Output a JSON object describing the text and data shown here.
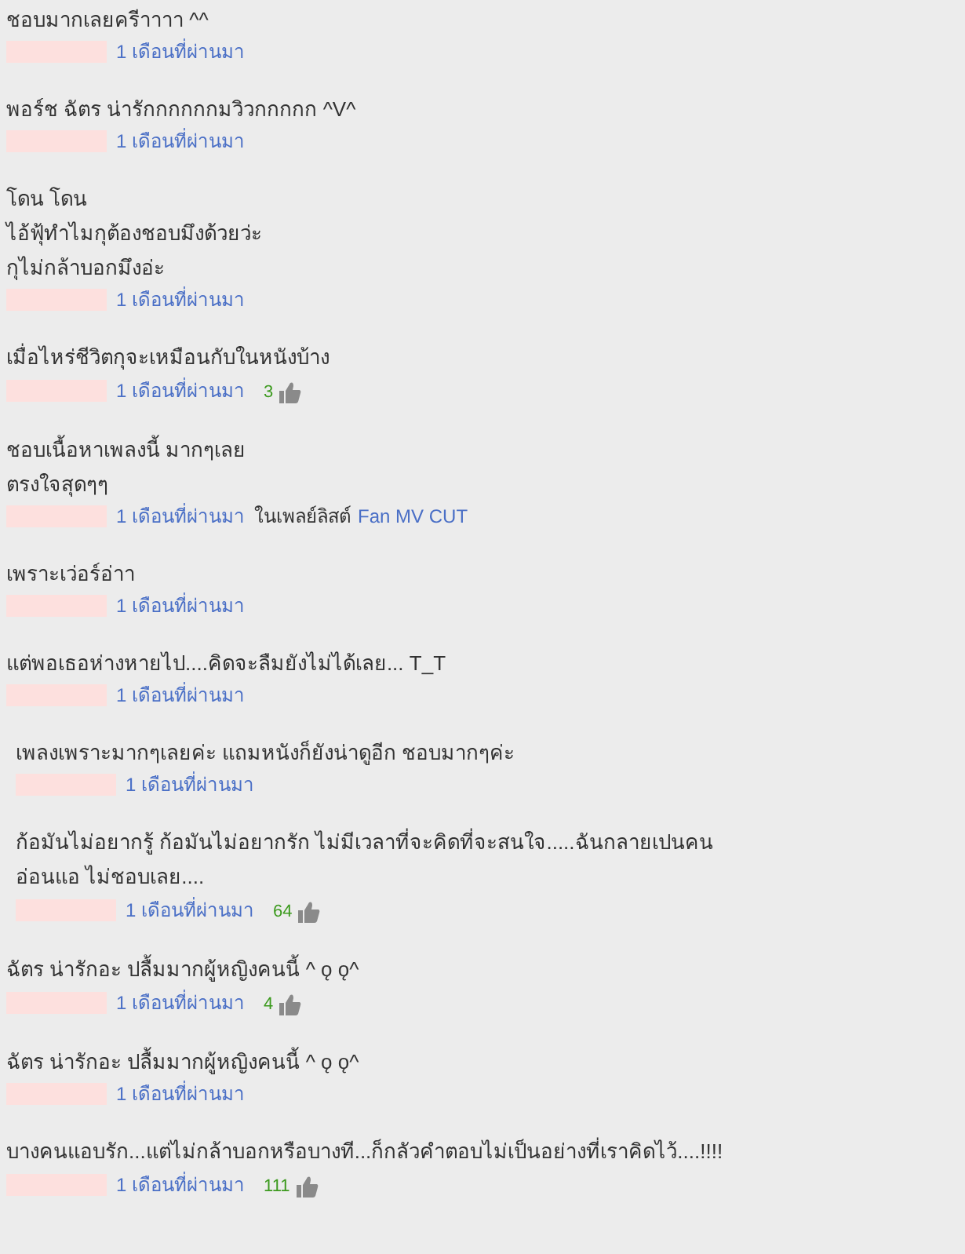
{
  "comments": [
    {
      "kind": "comment",
      "author_redacted": true,
      "lines": [
        "ชอบมากเลยครีาาาา ^^"
      ],
      "time": "1 เดือนที่ผ่านมา"
    },
    {
      "kind": "comment",
      "author_redacted": true,
      "lines": [
        "พอร์ช ฉัตร น่ารักกกกกกมวิวกกกกก ^V^"
      ],
      "time": "1 เดือนที่ผ่านมา"
    },
    {
      "kind": "comment",
      "author_redacted": true,
      "lines": [
        "โดน โดน",
        "ไอ้ฟุ้ทำไมกุต้องชอบมึงด้วยว่ะ",
        "กุไม่กล้าบอกมึงอ่ะ"
      ],
      "time": "1 เดือนที่ผ่านมา"
    },
    {
      "kind": "comment",
      "author_redacted": true,
      "lines": [
        "เมื่อไหร่ชีวิตกุจะเหมือนกับในหนังบ้าง"
      ],
      "time": "1 เดือนที่ผ่านมา",
      "likes": "3"
    },
    {
      "kind": "comment",
      "author_redacted": true,
      "lines": [
        "ชอบเนื้อหาเพลงนี้ มากๆเลย",
        "ตรงใจสุดๆๆ"
      ],
      "time": "1 เดือนที่ผ่านมา",
      "playlist_label": "ในเพลย์ลิสต์",
      "playlist": "Fan MV CUT"
    },
    {
      "kind": "comment",
      "author_redacted": true,
      "lines": [
        "เพราะเว่อร์อ่าา"
      ],
      "time": "1 เดือนที่ผ่านมา"
    },
    {
      "kind": "comment",
      "author_redacted": true,
      "lines": [
        "แต่พอเธอห่างหายไป....คิดจะลืมยังไม่ได้เลย... T_T"
      ],
      "time": "1 เดือนที่ผ่านมา"
    },
    {
      "kind": "reply",
      "author_redacted": true,
      "lines": [
        "เพลงเพราะมากๆเลยค่ะ แถมหนังก็ยังน่าดูอีก ชอบมากๆค่ะ"
      ],
      "time": "1 เดือนที่ผ่านมา"
    },
    {
      "kind": "reply",
      "author_redacted": true,
      "lines": [
        "ก้อมันไม่อยากรู้ ก้อมันไม่อยากรัก ไม่มีเวลาที่จะคิดที่จะสนใจ.....ฉันกลายเปนคน",
        "อ่อนแอ ไม่ชอบเลย...."
      ],
      "time": "1 เดือนที่ผ่านมา",
      "likes": "64"
    },
    {
      "kind": "comment",
      "author_redacted": true,
      "lines": [
        "ฉัตร น่ารักอะ ปลื้มมากผู้หญิงคนนี้ ^ ǫ ǫ^"
      ],
      "time": "1 เดือนที่ผ่านมา",
      "likes": "4"
    },
    {
      "kind": "comment",
      "author_redacted": true,
      "lines": [
        "ฉัตร น่ารักอะ ปลื้มมากผู้หญิงคนนี้ ^ ǫ ǫ^"
      ],
      "time": "1 เดือนที่ผ่านมา"
    },
    {
      "kind": "comment",
      "author_redacted": true,
      "lines": [
        "บางคนแอบรัก...แต่ไม่กล้าบอกหรือบางที...ก็กลัวคำตอบไม่เป็นอย่างที่เราคิดไว้....!!!!"
      ],
      "time": "1 เดือนที่ผ่านมา",
      "likes": "111"
    }
  ]
}
